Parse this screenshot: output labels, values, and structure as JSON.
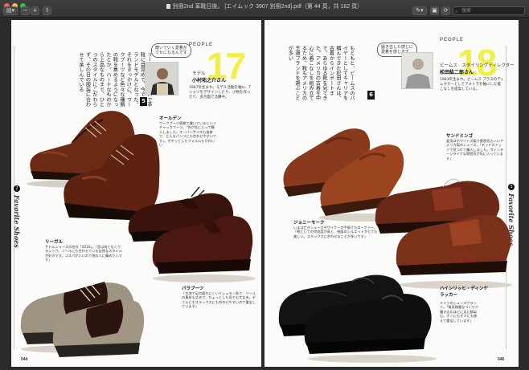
{
  "window": {
    "title": "別冊2nd 革靴日後。 [エイムック 3907 別冊2nd].pdf（第 44 頁，共 162 頁）",
    "toolbar": {
      "sidebar_icon": "sidebar-icon",
      "zoom_out_icon": "zoom-out-icon",
      "zoom_in_icon": "zoom-in-icon",
      "share_icon": "share-icon",
      "markup_icon": "pen-icon",
      "lock_icon": "lock-icon",
      "rotate_icon": "rotate-icon",
      "search_placeholder": "搜索"
    }
  },
  "left_page": {
    "people_label": "PEOPLE",
    "number": "17",
    "role": "モデル",
    "name": "小村祐之介さん",
    "desc": "1987年生まれ。モデル活動を軸に、Tシャツをデザインしたり、小物を作ったり、多方面で活躍中。",
    "bubble_line1": "磨いていく愛着が",
    "bubble_line2": "クセになるんです",
    "badge": "5",
    "body_text": "リーガルのシューズで革靴に目覚めて、今ではグランドモデルとなった。それをきっかけに、ワークブーツなど色々な種類の靴を集めるようになったとか。ハードなものから上品なものまで、ひとつのスタイルにこだわらず、その日の服装に合わせて楽しんでいる",
    "side_script": "Favorite Shoes",
    "side_mark": "2",
    "folio": "044",
    "captions": [
      {
        "title": "オールデン",
        "text": "ワークブーツ感覚で履いているというチャッカブーツ。「色が気に入って購入しました。オーバーサイズも抜群で、どんなパンツにも合わせやすいです」。ポテッとしたフォルムもかわいい"
      },
      {
        "title": "リーガル",
        "text": "サドルシューズの名作「2016」。「昔は何となくクラシック。ソールにも合わせている自然なスタイルが好きです。コスパがいいので他の人に薦めたいです」"
      },
      {
        "title": "パラブーツ",
        "text": "「生地で足の疲れにくいミシュラン系で、ソールの素材も丈夫で、ちょっとした雨でも大丈夫。デニムにもスラックスにも合わせやすいので重宝しています」"
      }
    ]
  },
  "right_page": {
    "people_label": "PEOPLE",
    "number": "18",
    "role": "ビームス　スタイリングディレクター",
    "name": "松田紘二郎さん",
    "desc": "1983年生まれ。ビームス プラスのディレクターとしてアメトラを軸にした着こなしを提案している。",
    "bubble_line1": "履き古した感じに",
    "bubble_line2": "愛着を感じます",
    "badge": "6",
    "body_text": "もともと、ビームスのバイヤーとしてキャリアを積んできた松田さんは、古着からインポートまで、あらゆる靴を見てきた。アメリカの古着を中心に着こなしを組み立てるため、靴もアメリカの王道ブランドを選ぶことが多い",
    "side_script": "Favorite Shoes",
    "side_mark": "3",
    "folio": "046",
    "captions": [
      {
        "title": "サンドミンゴ",
        "text": "愛用はホワイトズ製で雰囲気もいいアメリカ製のシューズ。「デッドストックで見つけて購入しました。ヴィンテージライクな雰囲気が気に入っています」"
      },
      {
        "title": "ジョニーモーク",
        "text": "いまは亡きシューズデザイナーが手掛けたローファー。「靴としての完成度が高く、細身のシルエットがとても美しい。スラックスに合わせることが多いです」"
      },
      {
        "title": "ハインリッヒ・ディンケラッカー",
        "text": "ドイツのシューズブランド。「質実剛健なつくりで履き込むほどに足に馴染む。オンにもオフにも使えて重宝しています」"
      }
    ]
  },
  "colors": {
    "accent_yellow": "#f3ef4a",
    "chrome": "#3a3a3a",
    "page": "#fbfbf9"
  }
}
